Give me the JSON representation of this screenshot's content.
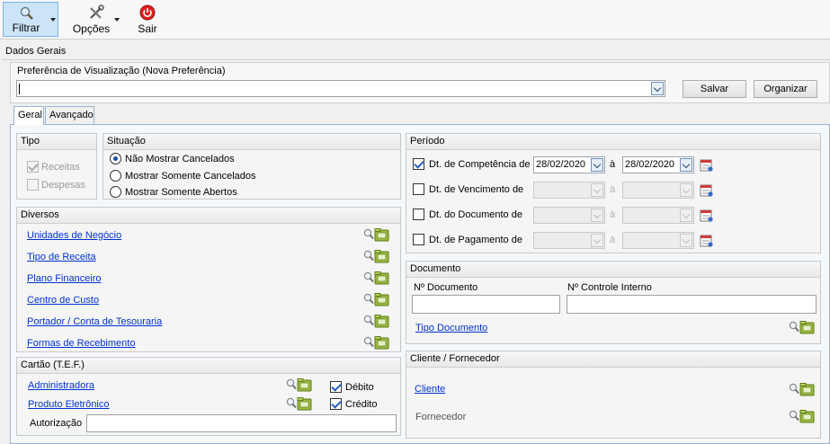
{
  "toolbar": {
    "filter_label": "Filtrar",
    "options_label": "Opções",
    "exit_label": "Sair"
  },
  "section_title": "Dados Gerais",
  "preference": {
    "label": "Preferência de Visualização (Nova Preferência)",
    "value": "",
    "save_label": "Salvar",
    "organize_label": "Organizar"
  },
  "tabs": [
    {
      "label": "Geral",
      "active": true
    },
    {
      "label": "Avançado",
      "active": false
    }
  ],
  "tipo": {
    "title": "Tipo",
    "items": [
      {
        "label": "Receitas",
        "checked": true,
        "enabled": false
      },
      {
        "label": "Despesas",
        "checked": false,
        "enabled": false
      }
    ]
  },
  "situacao": {
    "title": "Situação",
    "options": [
      {
        "label": "Não Mostrar Cancelados",
        "selected": true
      },
      {
        "label": "Mostrar Somente Cancelados",
        "selected": false
      },
      {
        "label": "Mostrar Somente Abertos",
        "selected": false
      }
    ]
  },
  "diversos": {
    "title": "Diversos",
    "links": [
      "Unidades de Negócio",
      "Tipo de Receita",
      "Plano Financeiro",
      "Centro de Custo",
      "Portador / Conta de Tesouraria",
      "Formas de Recebimento"
    ]
  },
  "cartao": {
    "title": "Cartão  (T.E.F.)",
    "links": [
      "Administradora",
      "Produto Eletrônico"
    ],
    "checks": [
      {
        "label": "Débito",
        "checked": true
      },
      {
        "label": "Crédito",
        "checked": true
      }
    ],
    "autorizacao_label": "Autorização",
    "autorizacao_value": ""
  },
  "periodo": {
    "title": "Período",
    "separator": "à",
    "rows": [
      {
        "label": "Dt. de Competência de",
        "checked": true,
        "from": "28/02/2020",
        "to": "28/02/2020",
        "enabled": true
      },
      {
        "label": "Dt. de Vencimento de",
        "checked": false,
        "from": "",
        "to": "",
        "enabled": false
      },
      {
        "label": "Dt. do Documento de",
        "checked": false,
        "from": "",
        "to": "",
        "enabled": false
      },
      {
        "label": "Dt. de Pagamento de",
        "checked": false,
        "from": "",
        "to": "",
        "enabled": false
      }
    ]
  },
  "documento": {
    "title": "Documento",
    "num_label": "Nº Documento",
    "num_value": "",
    "ctrl_label": "Nº Controle Interno",
    "ctrl_value": "",
    "tipo_link": "Tipo Documento"
  },
  "cliente": {
    "title": "Cliente / Fornecedor",
    "cliente_link": "Cliente",
    "fornecedor_label": "Fornecedor"
  },
  "icons": {
    "filter": "magnifier-icon",
    "options": "tools-icon",
    "exit": "power-icon",
    "lookup": "search-folder-icon",
    "calendar": "calendar-icon"
  }
}
